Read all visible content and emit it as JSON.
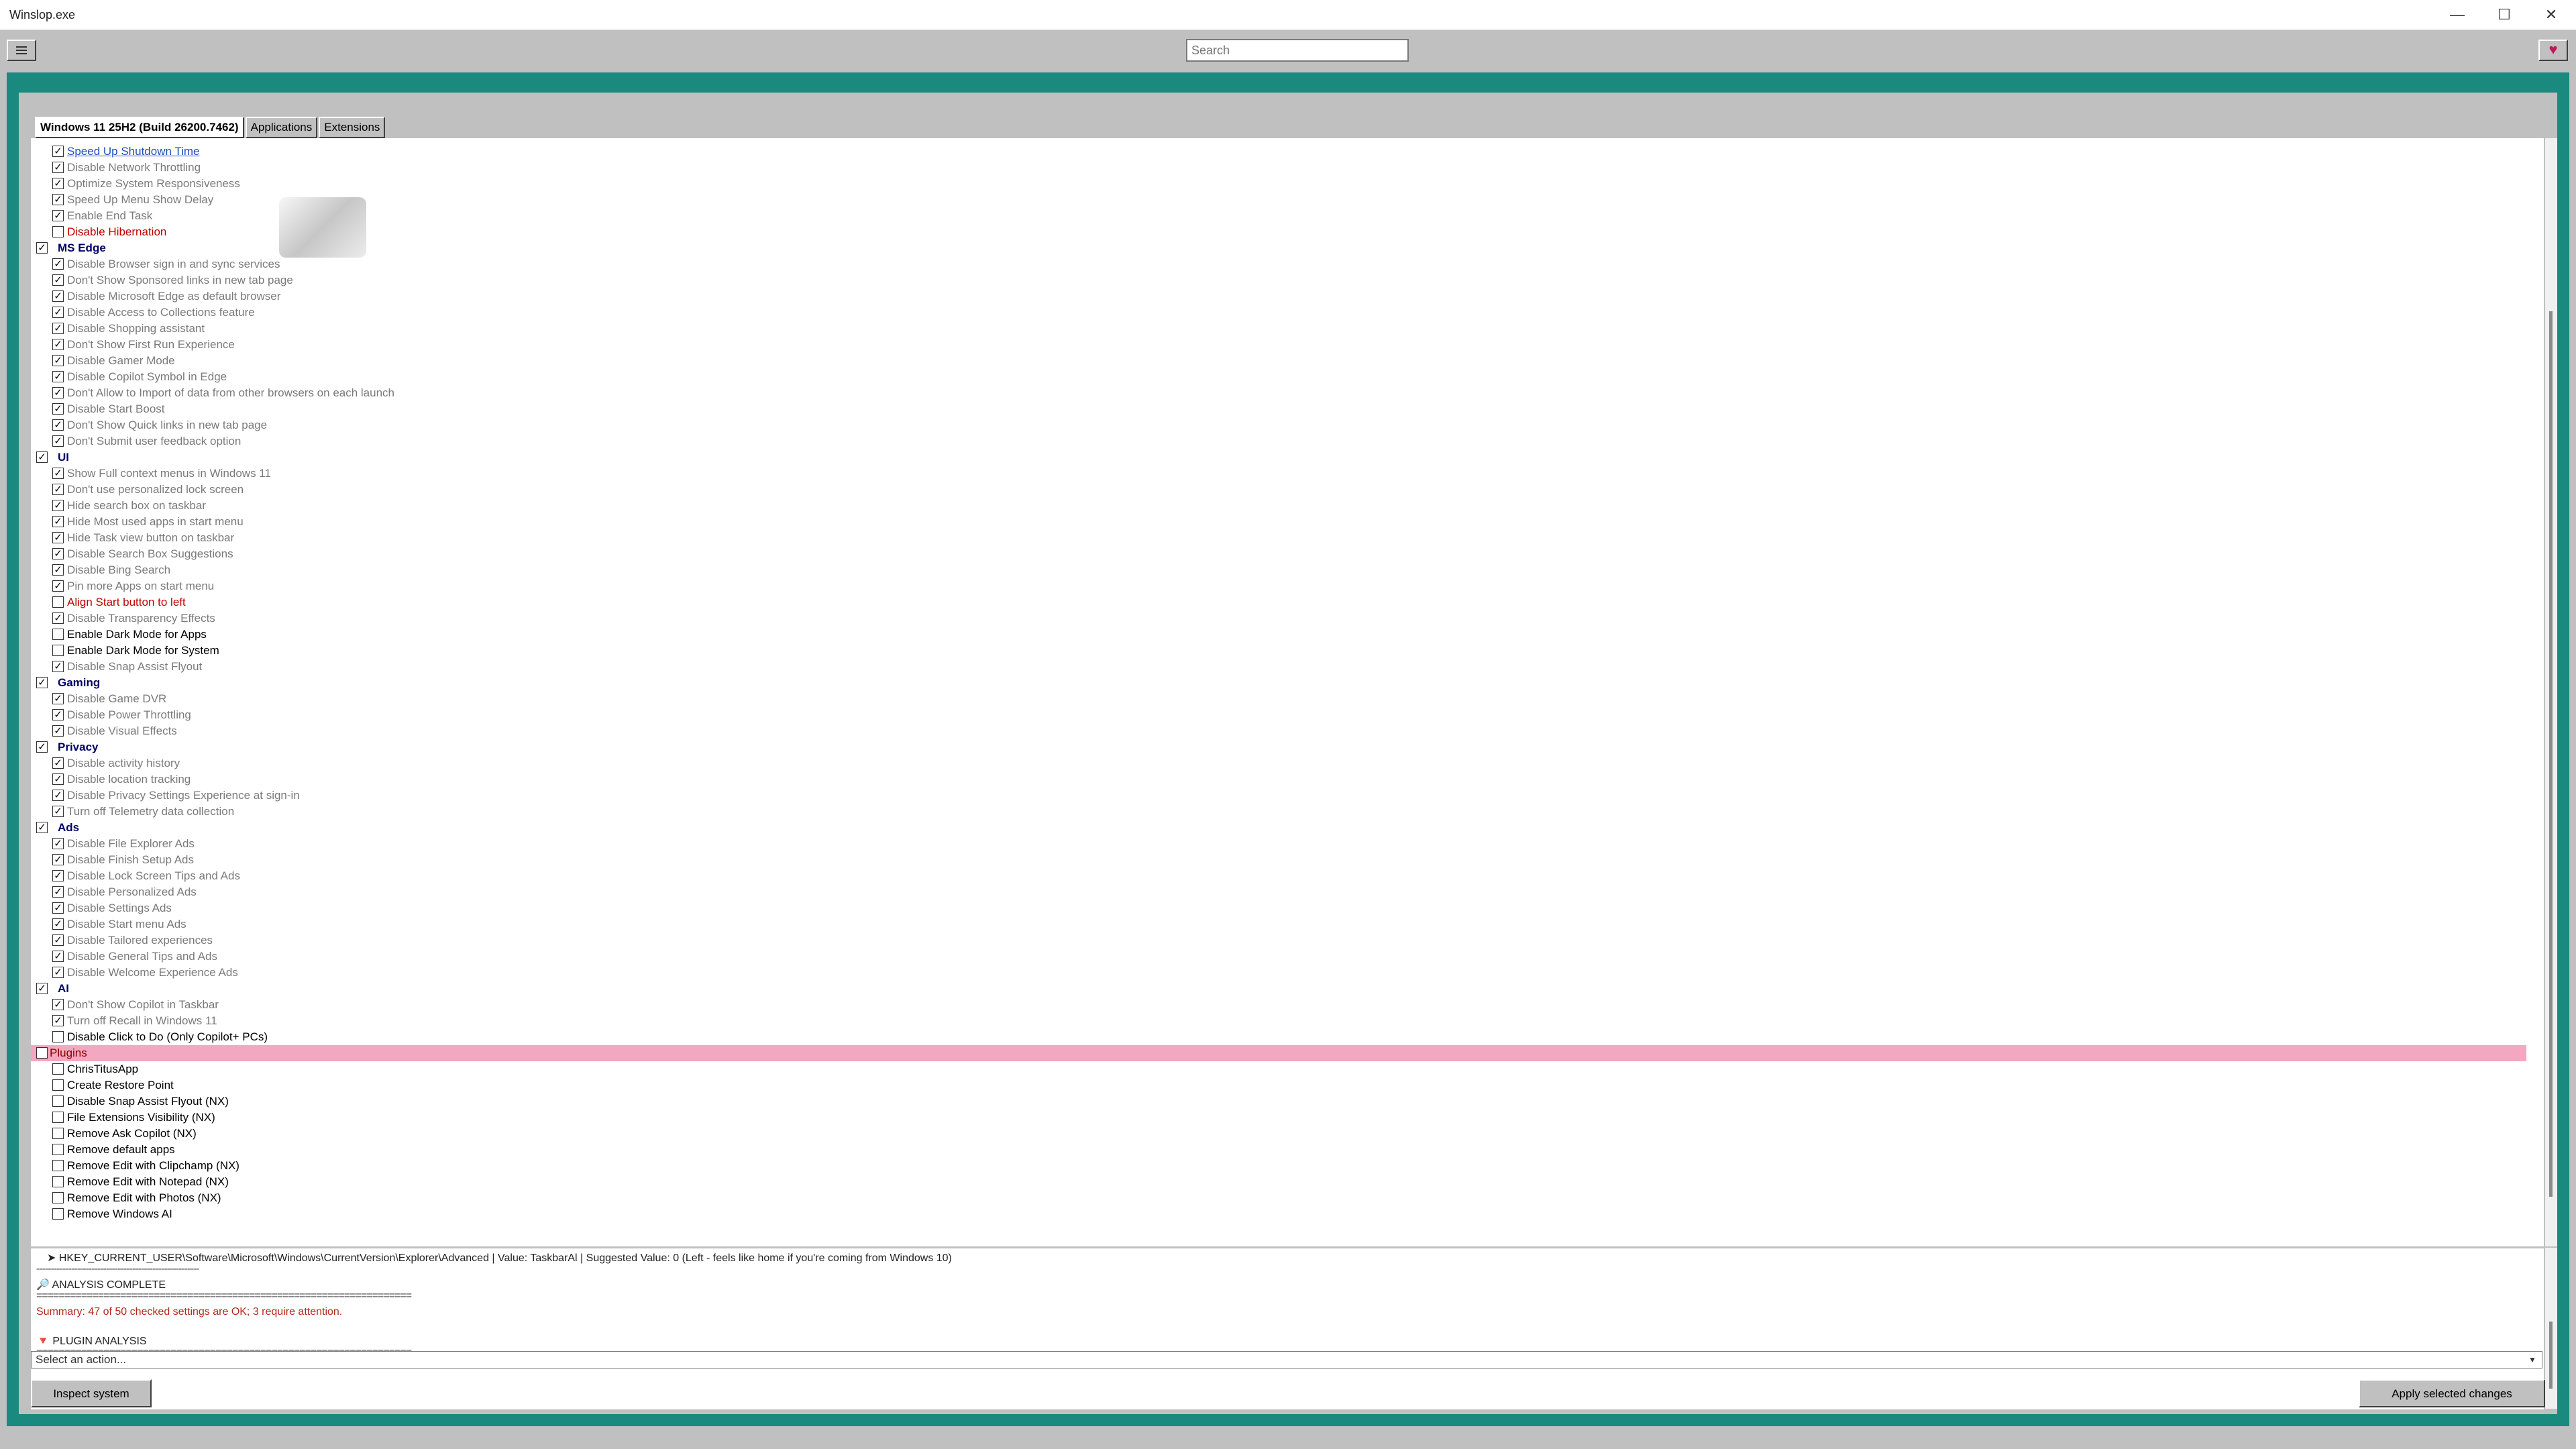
{
  "window": {
    "title": "Winslop.exe",
    "minimize": "—",
    "maximize": "☐",
    "close": "✕"
  },
  "toolbar": {
    "search_placeholder": "Search",
    "heart": "♥"
  },
  "tabs": [
    "Windows 11 25H2 (Build 26200.7462)",
    "Applications",
    "Extensions"
  ],
  "rows": [
    {
      "kind": "item",
      "label": "Speed Up Shutdown Time",
      "checked": true,
      "style": "link"
    },
    {
      "kind": "item",
      "label": "Disable Network Throttling",
      "checked": true,
      "style": "gray"
    },
    {
      "kind": "item",
      "label": "Optimize System Responsiveness",
      "checked": true,
      "style": "gray"
    },
    {
      "kind": "item",
      "label": "Speed Up Menu Show Delay",
      "checked": true,
      "style": "gray"
    },
    {
      "kind": "item",
      "label": "Enable End Task",
      "checked": true,
      "style": "gray"
    },
    {
      "kind": "item",
      "label": "Disable Hibernation",
      "checked": false,
      "style": "warn"
    },
    {
      "kind": "cat",
      "label": "MS Edge",
      "checked": true
    },
    {
      "kind": "item",
      "label": "Disable Browser sign in and sync services",
      "checked": true,
      "style": "gray"
    },
    {
      "kind": "item",
      "label": "Don't Show Sponsored links in new tab page",
      "checked": true,
      "style": "gray"
    },
    {
      "kind": "item",
      "label": "Disable Microsoft Edge as default browser",
      "checked": true,
      "style": "gray"
    },
    {
      "kind": "item",
      "label": "Disable Access to Collections feature",
      "checked": true,
      "style": "gray"
    },
    {
      "kind": "item",
      "label": "Disable Shopping assistant",
      "checked": true,
      "style": "gray"
    },
    {
      "kind": "item",
      "label": "Don't Show First Run Experience",
      "checked": true,
      "style": "gray"
    },
    {
      "kind": "item",
      "label": "Disable Gamer Mode",
      "checked": true,
      "style": "gray"
    },
    {
      "kind": "item",
      "label": "Disable Copilot Symbol in Edge",
      "checked": true,
      "style": "gray"
    },
    {
      "kind": "item",
      "label": "Don't Allow to Import of data from other browsers on each launch",
      "checked": true,
      "style": "gray"
    },
    {
      "kind": "item",
      "label": "Disable Start Boost",
      "checked": true,
      "style": "gray"
    },
    {
      "kind": "item",
      "label": "Don't Show Quick links in new tab page",
      "checked": true,
      "style": "gray"
    },
    {
      "kind": "item",
      "label": "Don't Submit user feedback option",
      "checked": true,
      "style": "gray"
    },
    {
      "kind": "cat",
      "label": "UI",
      "checked": true
    },
    {
      "kind": "item",
      "label": "Show Full context menus in Windows 11",
      "checked": true,
      "style": "gray"
    },
    {
      "kind": "item",
      "label": "Don't use personalized lock screen",
      "checked": true,
      "style": "gray"
    },
    {
      "kind": "item",
      "label": "Hide search box on taskbar",
      "checked": true,
      "style": "gray"
    },
    {
      "kind": "item",
      "label": "Hide Most used apps in start menu",
      "checked": true,
      "style": "gray"
    },
    {
      "kind": "item",
      "label": "Hide Task view button on taskbar",
      "checked": true,
      "style": "gray"
    },
    {
      "kind": "item",
      "label": "Disable Search Box Suggestions",
      "checked": true,
      "style": "gray"
    },
    {
      "kind": "item",
      "label": "Disable Bing Search",
      "checked": true,
      "style": "gray"
    },
    {
      "kind": "item",
      "label": "Pin more Apps on start menu",
      "checked": true,
      "style": "gray"
    },
    {
      "kind": "item",
      "label": "Align Start button to left",
      "checked": false,
      "style": "warn"
    },
    {
      "kind": "item",
      "label": "Disable Transparency Effects",
      "checked": true,
      "style": "gray"
    },
    {
      "kind": "item",
      "label": "Enable Dark Mode for Apps",
      "checked": false,
      "style": "normal"
    },
    {
      "kind": "item",
      "label": "Enable Dark Mode for System",
      "checked": false,
      "style": "normal"
    },
    {
      "kind": "item",
      "label": "Disable Snap Assist Flyout",
      "checked": true,
      "style": "gray"
    },
    {
      "kind": "cat",
      "label": "Gaming",
      "checked": true
    },
    {
      "kind": "item",
      "label": "Disable Game DVR",
      "checked": true,
      "style": "gray"
    },
    {
      "kind": "item",
      "label": "Disable Power Throttling",
      "checked": true,
      "style": "gray"
    },
    {
      "kind": "item",
      "label": "Disable Visual Effects",
      "checked": true,
      "style": "gray"
    },
    {
      "kind": "cat",
      "label": "Privacy",
      "checked": true
    },
    {
      "kind": "item",
      "label": "Disable activity history",
      "checked": true,
      "style": "gray"
    },
    {
      "kind": "item",
      "label": "Disable location tracking",
      "checked": true,
      "style": "gray"
    },
    {
      "kind": "item",
      "label": "Disable Privacy Settings Experience at sign-in",
      "checked": true,
      "style": "gray"
    },
    {
      "kind": "item",
      "label": "Turn off Telemetry data collection",
      "checked": true,
      "style": "gray"
    },
    {
      "kind": "cat",
      "label": "Ads",
      "checked": true
    },
    {
      "kind": "item",
      "label": "Disable File Explorer Ads",
      "checked": true,
      "style": "gray"
    },
    {
      "kind": "item",
      "label": "Disable Finish Setup Ads",
      "checked": true,
      "style": "gray"
    },
    {
      "kind": "item",
      "label": "Disable Lock Screen Tips and Ads",
      "checked": true,
      "style": "gray"
    },
    {
      "kind": "item",
      "label": "Disable Personalized Ads",
      "checked": true,
      "style": "gray"
    },
    {
      "kind": "item",
      "label": "Disable Settings Ads",
      "checked": true,
      "style": "gray"
    },
    {
      "kind": "item",
      "label": "Disable Start menu Ads",
      "checked": true,
      "style": "gray"
    },
    {
      "kind": "item",
      "label": "Disable Tailored experiences",
      "checked": true,
      "style": "gray"
    },
    {
      "kind": "item",
      "label": "Disable General Tips and Ads",
      "checked": true,
      "style": "gray"
    },
    {
      "kind": "item",
      "label": "Disable Welcome Experience Ads",
      "checked": true,
      "style": "gray"
    },
    {
      "kind": "cat",
      "label": "AI",
      "checked": true
    },
    {
      "kind": "item",
      "label": "Don't Show Copilot in Taskbar",
      "checked": true,
      "style": "gray"
    },
    {
      "kind": "item",
      "label": "Turn off Recall in Windows 11",
      "checked": true,
      "style": "gray"
    },
    {
      "kind": "item",
      "label": "Disable Click to Do (Only Copilot+ PCs)",
      "checked": false,
      "style": "normal"
    },
    {
      "kind": "cat",
      "label": "Plugins",
      "checked": false,
      "style": "plugin"
    },
    {
      "kind": "item",
      "label": "ChrisTitusApp",
      "checked": false,
      "style": "normal"
    },
    {
      "kind": "item",
      "label": "Create Restore Point",
      "checked": false,
      "style": "normal"
    },
    {
      "kind": "item",
      "label": "Disable Snap Assist Flyout (NX)",
      "checked": false,
      "style": "normal"
    },
    {
      "kind": "item",
      "label": "File Extensions Visibility (NX)",
      "checked": false,
      "style": "normal"
    },
    {
      "kind": "item",
      "label": "Remove Ask Copilot (NX)",
      "checked": false,
      "style": "normal"
    },
    {
      "kind": "item",
      "label": "Remove default apps",
      "checked": false,
      "style": "normal"
    },
    {
      "kind": "item",
      "label": "Remove Edit with Clipchamp (NX)",
      "checked": false,
      "style": "normal"
    },
    {
      "kind": "item",
      "label": "Remove Edit with Notepad (NX)",
      "checked": false,
      "style": "normal"
    },
    {
      "kind": "item",
      "label": "Remove Edit with Photos (NX)",
      "checked": false,
      "style": "normal"
    },
    {
      "kind": "item",
      "label": "Remove Windows AI",
      "checked": false,
      "style": "normal"
    }
  ],
  "log": {
    "registry_line": "➤  HKEY_CURRENT_USER\\Software\\Microsoft\\Windows\\CurrentVersion\\Explorer\\Advanced | Value: TaskbarAl | Suggested Value: 0 (Left - feels like home if you're coming from Windows 10)",
    "separator_short": "--------------------------------------------------------",
    "analysis_complete": "🔎 ANALYSIS COMPLETE",
    "separator": "===================================================================",
    "summary": "Summary: 47 of 50 checked settings are OK; 3 require attention.",
    "plugin_analysis": "🔻 PLUGIN ANALYSIS"
  },
  "action_select": {
    "value": "Select an action...",
    "arrow": "▼"
  },
  "buttons": {
    "inspect": "Inspect system",
    "apply": "Apply selected changes"
  }
}
